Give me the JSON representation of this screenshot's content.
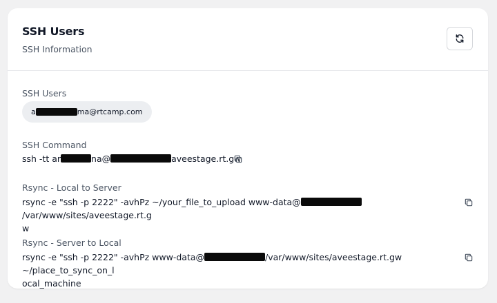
{
  "header": {
    "title": "SSH Users",
    "subtitle": "SSH Information"
  },
  "icons": {
    "refresh": "refresh-icon",
    "copy": "copy-icon"
  },
  "ssh_users": {
    "label": "SSH Users",
    "user_prefix": "a",
    "user_suffix": "ma@rtcamp.com"
  },
  "ssh_command": {
    "label": "SSH Command",
    "prefix": "ssh -tt ar",
    "mid": "na@",
    "suffix": "aveestage.rt.gw"
  },
  "rsync_to_server": {
    "label": "Rsync - Local to Server",
    "part1": "rsync -e \"ssh -p 2222\" -avhPz ~/your_file_to_upload www-data@",
    "part2": "/var/www/sites/aveestage.rt.g",
    "part3": "w"
  },
  "rsync_to_local": {
    "label": "Rsync - Server to Local",
    "part1": "rsync -e \"ssh -p 2222\" -avhPz www-data@",
    "part2": "/var/www/sites/aveestage.rt.gw ~/place_to_sync_on_l",
    "part3": "ocal_machine"
  }
}
